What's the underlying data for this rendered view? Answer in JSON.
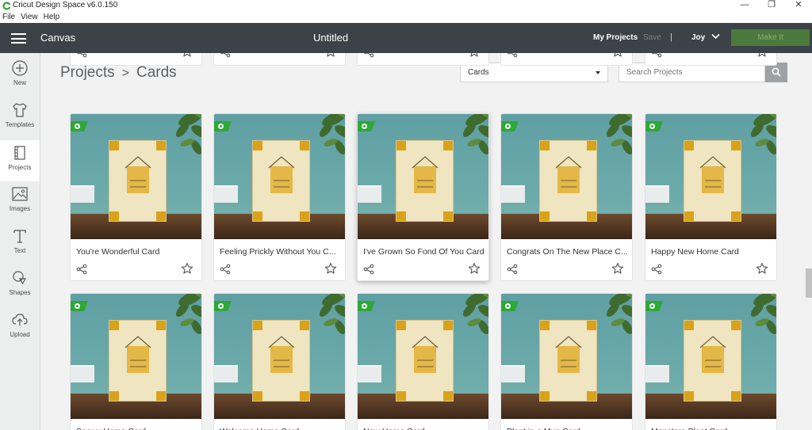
{
  "window": {
    "title": "Cricut Design Space  v6.0.150",
    "menus": [
      "File",
      "View",
      "Help"
    ],
    "controls": [
      "—",
      "❐",
      "✕"
    ]
  },
  "header": {
    "canvas_label": "Canvas",
    "doc_title": "Untitled",
    "my_projects": "My Projects",
    "save": "Save",
    "separator": "|",
    "user": "Joy",
    "make_it": "Make It"
  },
  "sidebar": {
    "items": [
      {
        "label": "New",
        "icon": "plus-circle-icon"
      },
      {
        "label": "Templates",
        "icon": "tshirt-icon"
      },
      {
        "label": "Projects",
        "icon": "projects-icon"
      },
      {
        "label": "Images",
        "icon": "image-icon"
      },
      {
        "label": "Text",
        "icon": "text-icon"
      },
      {
        "label": "Shapes",
        "icon": "shapes-icon"
      },
      {
        "label": "Upload",
        "icon": "upload-icon"
      }
    ]
  },
  "breadcrumb": {
    "root": "Projects",
    "separator": ">",
    "current": "Cards"
  },
  "filter": {
    "selected": "Cards"
  },
  "search": {
    "placeholder": "Search Projects"
  },
  "cards": [
    {
      "title": "You're Wonderful Card"
    },
    {
      "title": "Feeling Prickly Without You C..."
    },
    {
      "title": "I've Grown So Fond Of You Card"
    },
    {
      "title": "Congrats On The New Place C..."
    },
    {
      "title": "Happy New Home Card"
    },
    {
      "title": "Snowy Home Card"
    },
    {
      "title": "Welcome Home Card"
    },
    {
      "title": "New Home Card"
    },
    {
      "title": "Plant in a Mug Card"
    },
    {
      "title": "Monstera Plant Card"
    }
  ],
  "colors": {
    "header": "#3c4247",
    "access_badge": "#2ea836",
    "make_it": "#4a7a3b",
    "card_gold": "#d9a21b",
    "card_cream": "#f0e5c1"
  }
}
